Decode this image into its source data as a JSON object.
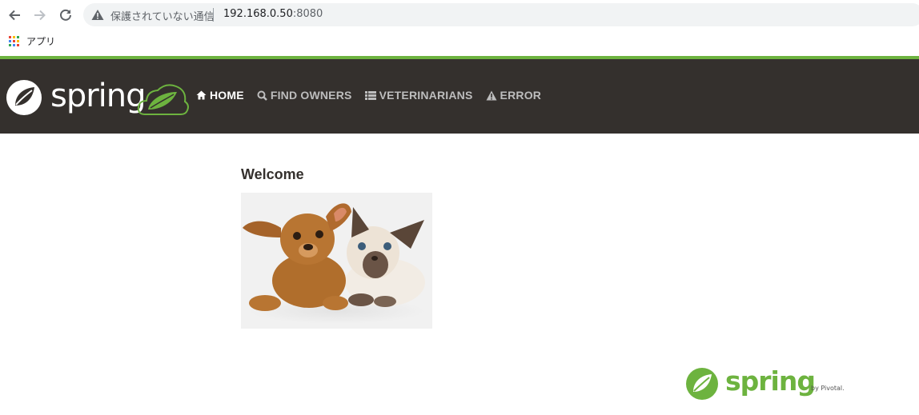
{
  "browser": {
    "security_label": "保護されていない通信",
    "url_host": "192.168.0.50",
    "url_port": ":8080",
    "bookmarks_apps_label": "アプリ"
  },
  "navbar": {
    "brand": "spring",
    "items": [
      {
        "label": "HOME",
        "icon": "home-icon",
        "active": true
      },
      {
        "label": "FIND OWNERS",
        "icon": "search-icon",
        "active": false
      },
      {
        "label": "VETERINARIANS",
        "icon": "list-icon",
        "active": false
      },
      {
        "label": "ERROR",
        "icon": "warning-icon",
        "active": false
      }
    ]
  },
  "main": {
    "title": "Welcome",
    "image": "pets-photo"
  },
  "footer": {
    "brand": "spring",
    "by_label": "by Pivotal."
  },
  "colors": {
    "spring_green": "#6db33f",
    "navbar_bg": "#34302d"
  }
}
